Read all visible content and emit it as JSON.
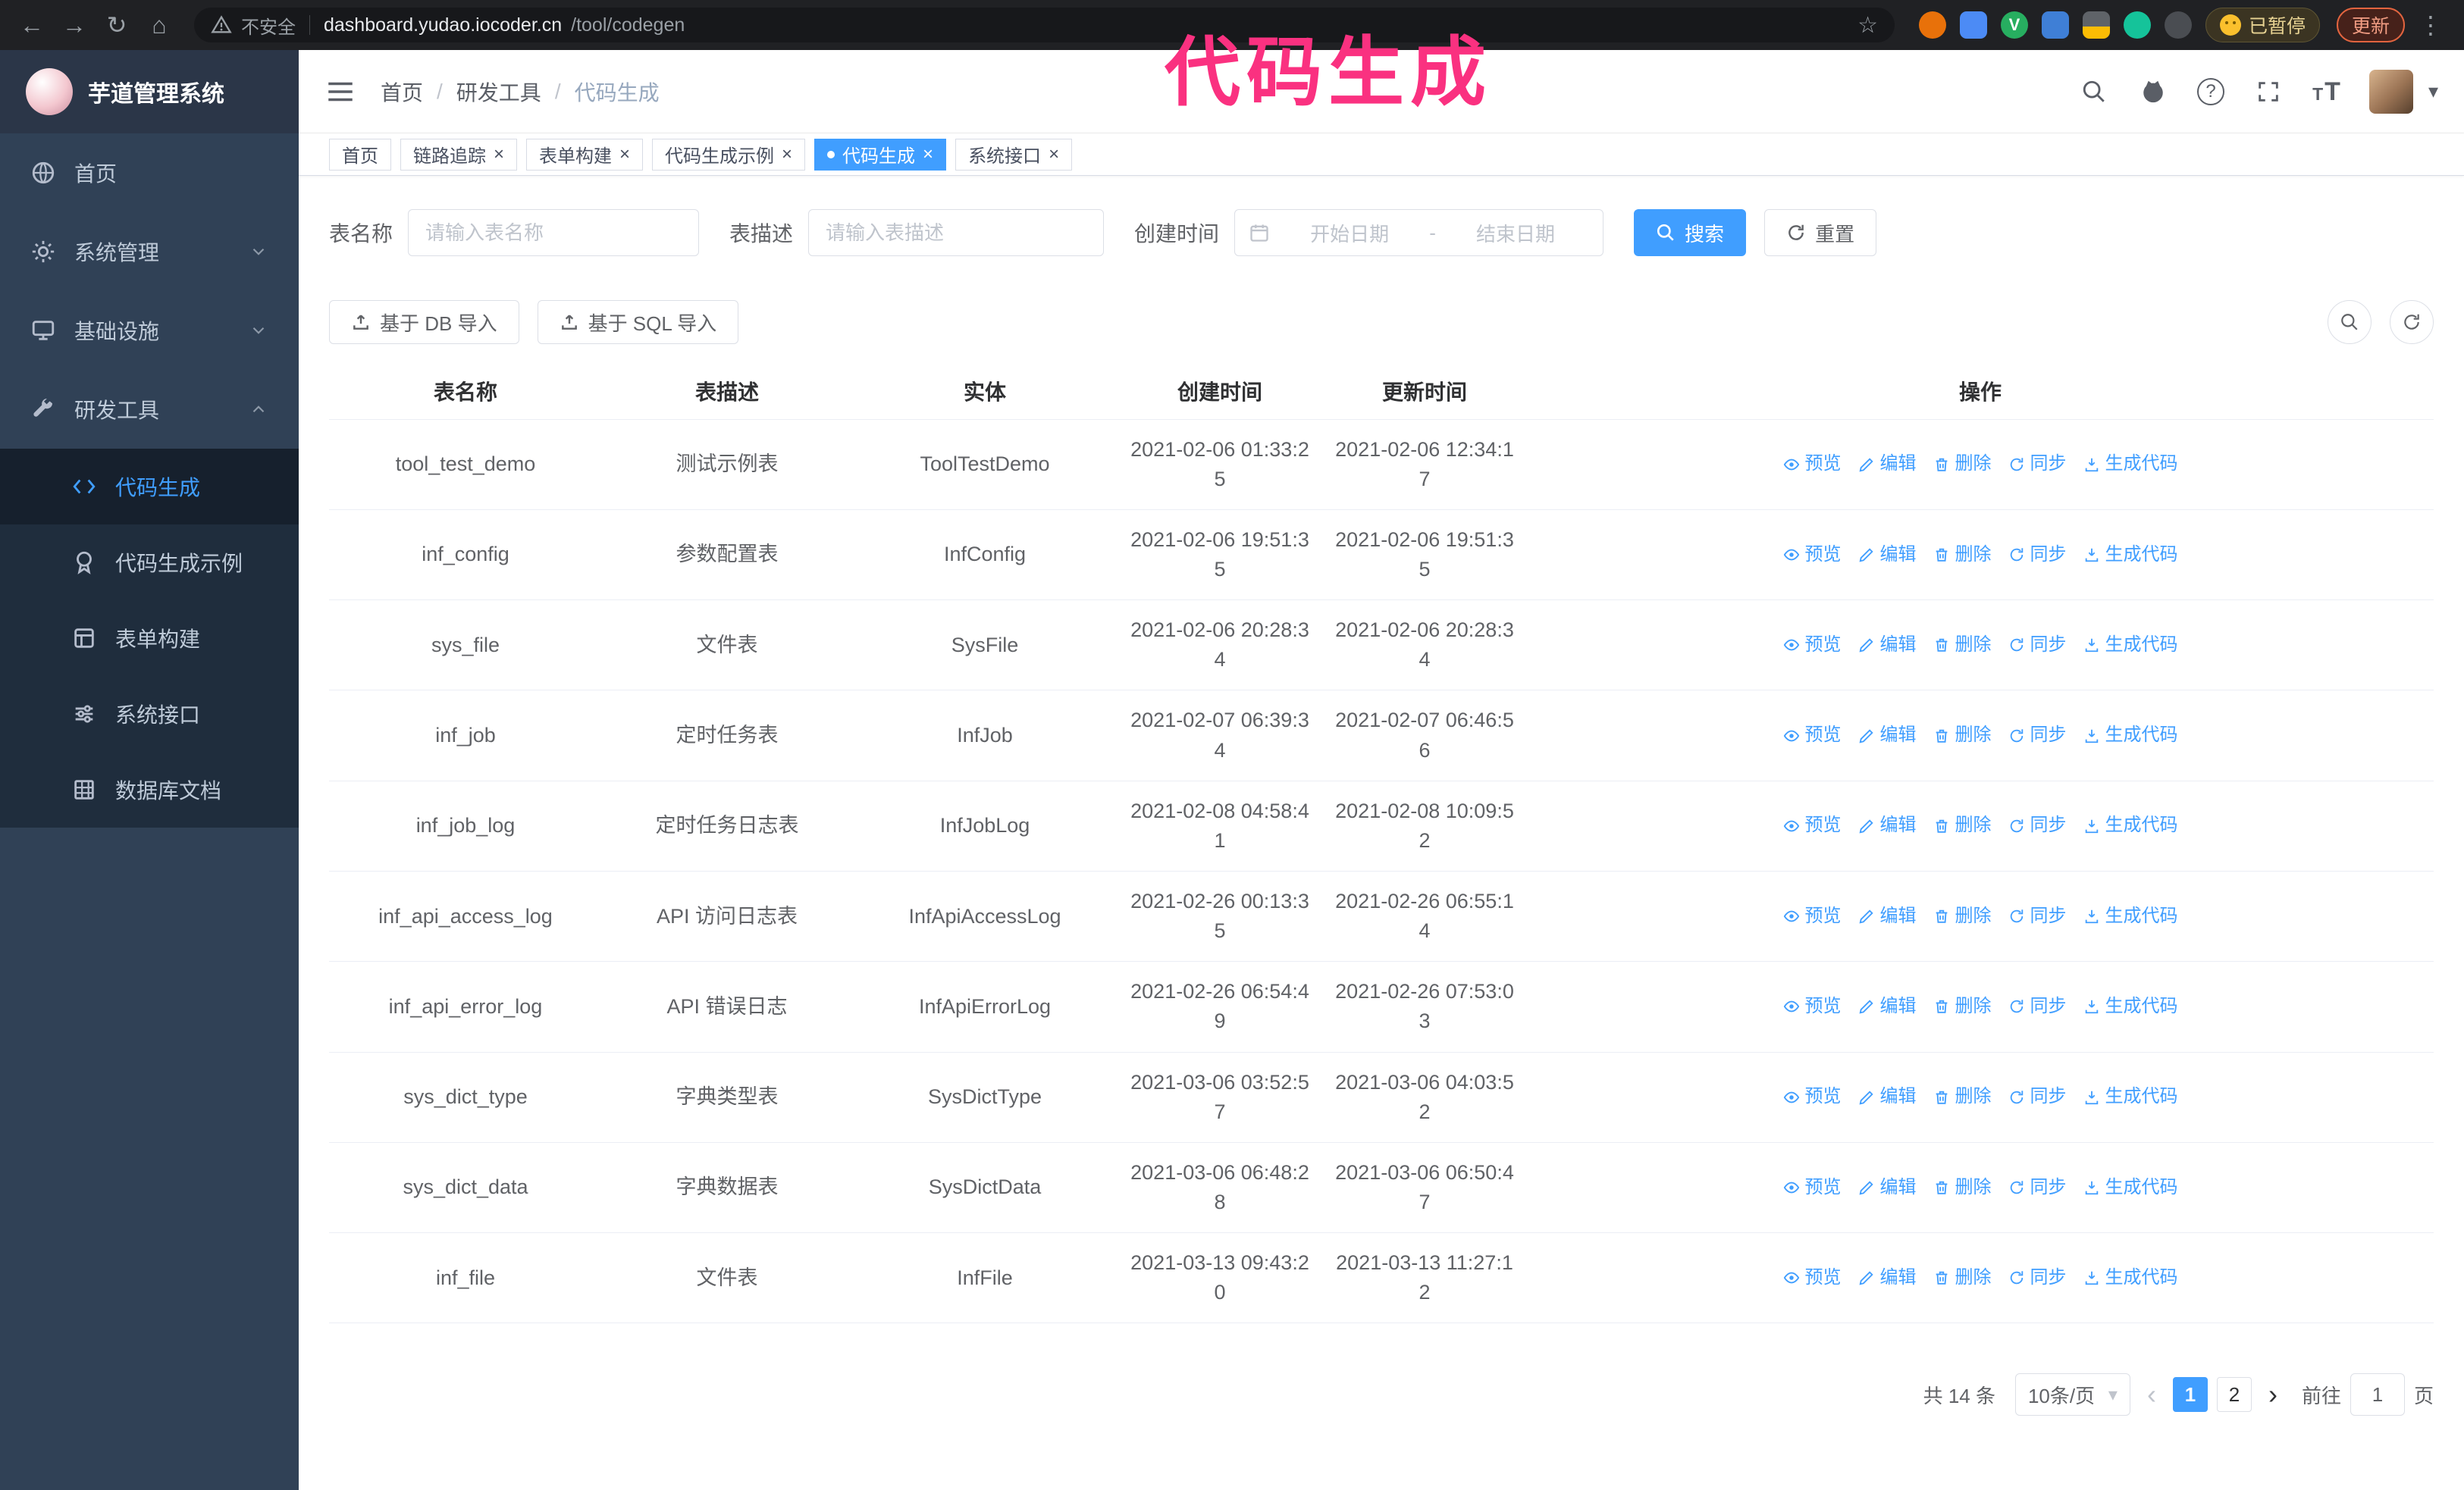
{
  "browser": {
    "security_text": "不安全",
    "url_host": "dashboard.yudao.iocoder.cn",
    "url_path": "/tool/codegen",
    "extension_letter": "V",
    "paused_label": "已暂停",
    "update_label": "更新"
  },
  "icons": {
    "back": "←",
    "forward": "→",
    "reload": "↻",
    "home": "⌂",
    "warning": "⚠",
    "star": "☆",
    "kebab": "⋮",
    "close": "×",
    "slash": "/",
    "caret_down": "▾",
    "question": "?",
    "text_size_big": "T",
    "text_size_small": "T",
    "prev": "‹",
    "next": "›",
    "date_separator": "-"
  },
  "annotation": {
    "text": "代码生成",
    "color": "#fa3180"
  },
  "sidebar": {
    "title": "芋道管理系统",
    "items": [
      {
        "label": "首页"
      },
      {
        "label": "系统管理",
        "chevron": "down"
      },
      {
        "label": "基础设施",
        "chevron": "down"
      },
      {
        "label": "研发工具",
        "chevron": "up"
      }
    ],
    "subitems": [
      {
        "label": "代码生成",
        "active": true
      },
      {
        "label": "代码生成示例"
      },
      {
        "label": "表单构建"
      },
      {
        "label": "系统接口"
      },
      {
        "label": "数据库文档"
      }
    ]
  },
  "header": {
    "breadcrumb": [
      "首页",
      "研发工具",
      "代码生成"
    ]
  },
  "tabs": [
    {
      "label": "首页",
      "affix": true
    },
    {
      "label": "链路追踪"
    },
    {
      "label": "表单构建"
    },
    {
      "label": "代码生成示例"
    },
    {
      "label": "代码生成",
      "active": true
    },
    {
      "label": "系统接口"
    }
  ],
  "filters": {
    "table_name_label": "表名称",
    "table_name_placeholder": "请输入表名称",
    "table_desc_label": "表描述",
    "table_desc_placeholder": "请输入表描述",
    "create_time_label": "创建时间",
    "date_start_placeholder": "开始日期",
    "date_end_placeholder": "结束日期",
    "search_button": "搜索",
    "reset_button": "重置"
  },
  "toolbar": {
    "import_db": "基于 DB 导入",
    "import_sql": "基于 SQL 导入"
  },
  "table": {
    "columns": [
      "表名称",
      "表描述",
      "实体",
      "创建时间",
      "更新时间",
      "操作"
    ],
    "actions": [
      "预览",
      "编辑",
      "删除",
      "同步",
      "生成代码"
    ],
    "rows": [
      {
        "name": "tool_test_demo",
        "desc": "测试示例表",
        "entity": "ToolTestDemo",
        "created": "2021-02-06 01:33:25",
        "updated": "2021-02-06 12:34:17"
      },
      {
        "name": "inf_config",
        "desc": "参数配置表",
        "entity": "InfConfig",
        "created": "2021-02-06 19:51:35",
        "updated": "2021-02-06 19:51:35"
      },
      {
        "name": "sys_file",
        "desc": "文件表",
        "entity": "SysFile",
        "created": "2021-02-06 20:28:34",
        "updated": "2021-02-06 20:28:34"
      },
      {
        "name": "inf_job",
        "desc": "定时任务表",
        "entity": "InfJob",
        "created": "2021-02-07 06:39:34",
        "updated": "2021-02-07 06:46:56"
      },
      {
        "name": "inf_job_log",
        "desc": "定时任务日志表",
        "entity": "InfJobLog",
        "created": "2021-02-08 04:58:41",
        "updated": "2021-02-08 10:09:52"
      },
      {
        "name": "inf_api_access_log",
        "desc": "API 访问日志表",
        "entity": "InfApiAccessLog",
        "created": "2021-02-26 00:13:35",
        "updated": "2021-02-26 06:55:14"
      },
      {
        "name": "inf_api_error_log",
        "desc": "API 错误日志",
        "entity": "InfApiErrorLog",
        "created": "2021-02-26 06:54:49",
        "updated": "2021-02-26 07:53:03"
      },
      {
        "name": "sys_dict_type",
        "desc": "字典类型表",
        "entity": "SysDictType",
        "created": "2021-03-06 03:52:57",
        "updated": "2021-03-06 04:03:52"
      },
      {
        "name": "sys_dict_data",
        "desc": "字典数据表",
        "entity": "SysDictData",
        "created": "2021-03-06 06:48:28",
        "updated": "2021-03-06 06:50:47"
      },
      {
        "name": "inf_file",
        "desc": "文件表",
        "entity": "InfFile",
        "created": "2021-03-13 09:43:20",
        "updated": "2021-03-13 11:27:12"
      }
    ]
  },
  "pagination": {
    "total": "共 14 条",
    "page_size": "10条/页",
    "pages": [
      {
        "label": "1",
        "active": true
      },
      {
        "label": "2"
      }
    ],
    "goto_label": "前往",
    "goto_value": "1",
    "goto_unit": "页"
  },
  "colors": {
    "accent": "#409eff",
    "annotation": "#fa3180",
    "sidebar_bg": "#304156",
    "submenu_bg": "#1f2d3d"
  }
}
